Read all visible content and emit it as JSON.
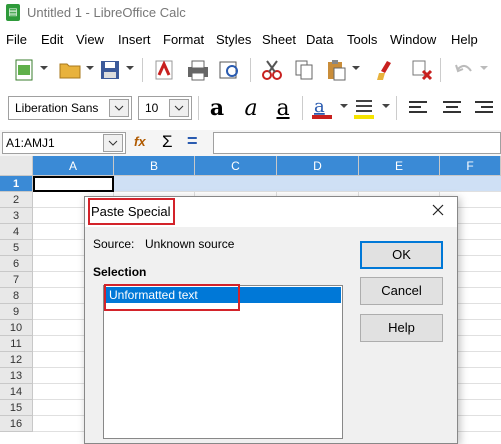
{
  "window": {
    "title": "Untitled 1 - LibreOffice Calc"
  },
  "menu": [
    "File",
    "Edit",
    "View",
    "Insert",
    "Format",
    "Styles",
    "Sheet",
    "Data",
    "Tools",
    "Window",
    "Help"
  ],
  "font": {
    "name": "Liberation Sans",
    "size": "10"
  },
  "formula_bar": {
    "name_box": "A1:AMJ1",
    "sigma": "Σ",
    "equals": "="
  },
  "columns": [
    "A",
    "B",
    "C",
    "D",
    "E",
    "F"
  ],
  "rows": [
    "1",
    "2",
    "3",
    "4",
    "5",
    "6",
    "7",
    "8",
    "9",
    "10",
    "11",
    "12",
    "13",
    "14",
    "15",
    "16"
  ],
  "dialog": {
    "title": "Paste Special",
    "source_label": "Source:",
    "source_value": "Unknown source",
    "selection_label": "Selection",
    "list_items": [
      "Unformatted text"
    ],
    "ok": "OK",
    "cancel": "Cancel",
    "help": "Help"
  },
  "colors": {
    "selection": "#3a8ad6",
    "highlight": "#d3232a",
    "list_selected": "#0078d7"
  }
}
